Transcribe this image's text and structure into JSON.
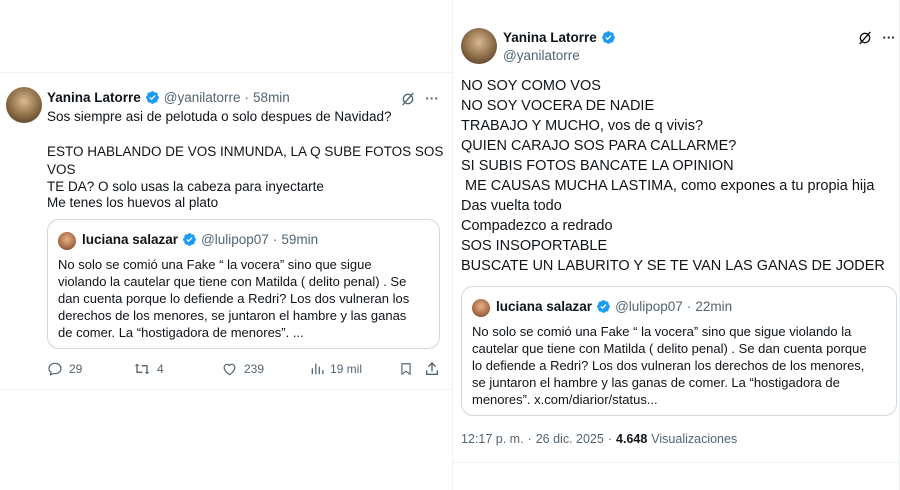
{
  "left": {
    "author_name": "Yanina Latorre",
    "author_handle": "@yanilatorre",
    "separator": "·",
    "time": "58min",
    "more": "···",
    "text_lines": [
      "Sos siempre asi de pelotuda o solo despues de  Navidad?",
      "",
      "ESTO HABLANDO DE VOS INMUNDA, LA Q SUBE FOTOS SOS",
      "VOS",
      "TE DA? O solo usas la cabeza para inyectarte",
      "Me tenes los huevos al plato"
    ],
    "quote": {
      "author_name": "luciana salazar",
      "author_handle": "@lulipop07",
      "separator": "·",
      "time": "59min",
      "text_lines": [
        "No solo se comió una Fake “ la vocera” sino que sigue",
        "violando la cautelar que tiene con Matilda ( delito penal) . Se",
        "dan cuenta porque lo defiende a Redri?  Los dos vulneran los",
        "derechos de los menores, se juntaron el hambre y las ganas",
        "de comer. La “hostigadora de menores”. ..."
      ]
    },
    "actions": {
      "replies": "29",
      "reposts": "4",
      "likes": "239",
      "views": "19 mil"
    }
  },
  "right": {
    "author_name": "Yanina Latorre",
    "author_handle": "@yanilatorre",
    "more": "···",
    "text_lines": [
      "NO SOY COMO VOS",
      "NO SOY VOCERA DE NADIE",
      "TRABAJO Y MUCHO, vos de q vivis?",
      "QUIEN CARAJO SOS PARA CALLARME?",
      "SI SUBIS FOTOS BANCATE LA OPINION",
      " ME CAUSAS MUCHA LASTIMA, como expones a tu propia hija",
      "Das vuelta todo",
      "Compadezco a redrado",
      "SOS INSOPORTABLE",
      "BUSCATE UN LABURITO Y SE TE VAN LAS GANAS DE JODER"
    ],
    "quote": {
      "author_name": "luciana salazar",
      "author_handle": "@lulipop07",
      "separator": "·",
      "time": "22min",
      "text_lines": [
        "No solo se comió una Fake “ la vocera” sino que sigue violando la",
        "cautelar que tiene con Matilda ( delito penal) . Se",
        "dan cuenta porque lo defiende a Redri?  Los dos vulneran los derechos de los menores,",
        "se juntaron el hambre y las ganas de comer. La “hostigadora de",
        "menores”. x.com/diarior/status..."
      ]
    },
    "meta": {
      "time": "12:17 p. m.",
      "separator": "·",
      "date": "26 dic. 2025",
      "separator2": "·",
      "views_count": "4.648",
      "views_label": "Visualizaciones"
    }
  },
  "colors": {
    "verified_blue": "#1d9bf0",
    "text": "#0f1419",
    "secondary": "#536471",
    "border": "#cfd9de"
  }
}
